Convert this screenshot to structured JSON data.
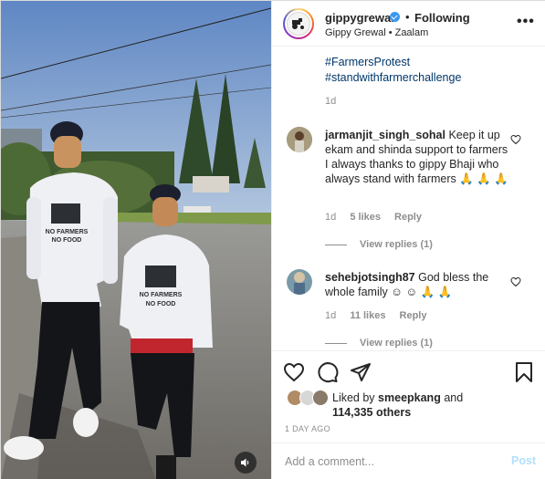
{
  "post": {
    "username": "gippygrewal",
    "separator": "•",
    "follow_status": "Following",
    "subtitle": "Gippy Grewal • Zaalam",
    "more_icon": "more-horizontal-icon"
  },
  "caption": {
    "tags": [
      "#FarmersProtest",
      "#standwithfarmerchallenge"
    ],
    "age": "1d"
  },
  "comments": [
    {
      "username": "jarmanjit_singh_sohal",
      "text": "Keep it up ekam and shinda support to farmers I always thanks to gippy Bhaji who always stand with farmers 🙏 🙏 🙏",
      "age": "1d",
      "likes": "5 likes",
      "reply_label": "Reply",
      "view_replies": "View replies (1)"
    },
    {
      "username": "sehebjotsingh87",
      "text": "God bless the whole family ☺ ☺ 🙏 🙏",
      "age": "1d",
      "likes": "11 likes",
      "reply_label": "Reply",
      "view_replies": "View replies (1)"
    }
  ],
  "likes": {
    "prefix": "Liked by",
    "user": "smeepkang",
    "joiner": "and",
    "others": "114,335 others"
  },
  "timestamp": "1 DAY AGO",
  "comment_box": {
    "placeholder": "Add a comment...",
    "post_label": "Post"
  },
  "media": {
    "shirt_text_line1": "NO FARMERS",
    "shirt_text_line2": "NO FOOD"
  },
  "colors": {
    "link": "#00376b",
    "verified": "#3897f0",
    "post_button_disabled": "#b2dffc",
    "muted": "#8e8e8e"
  }
}
